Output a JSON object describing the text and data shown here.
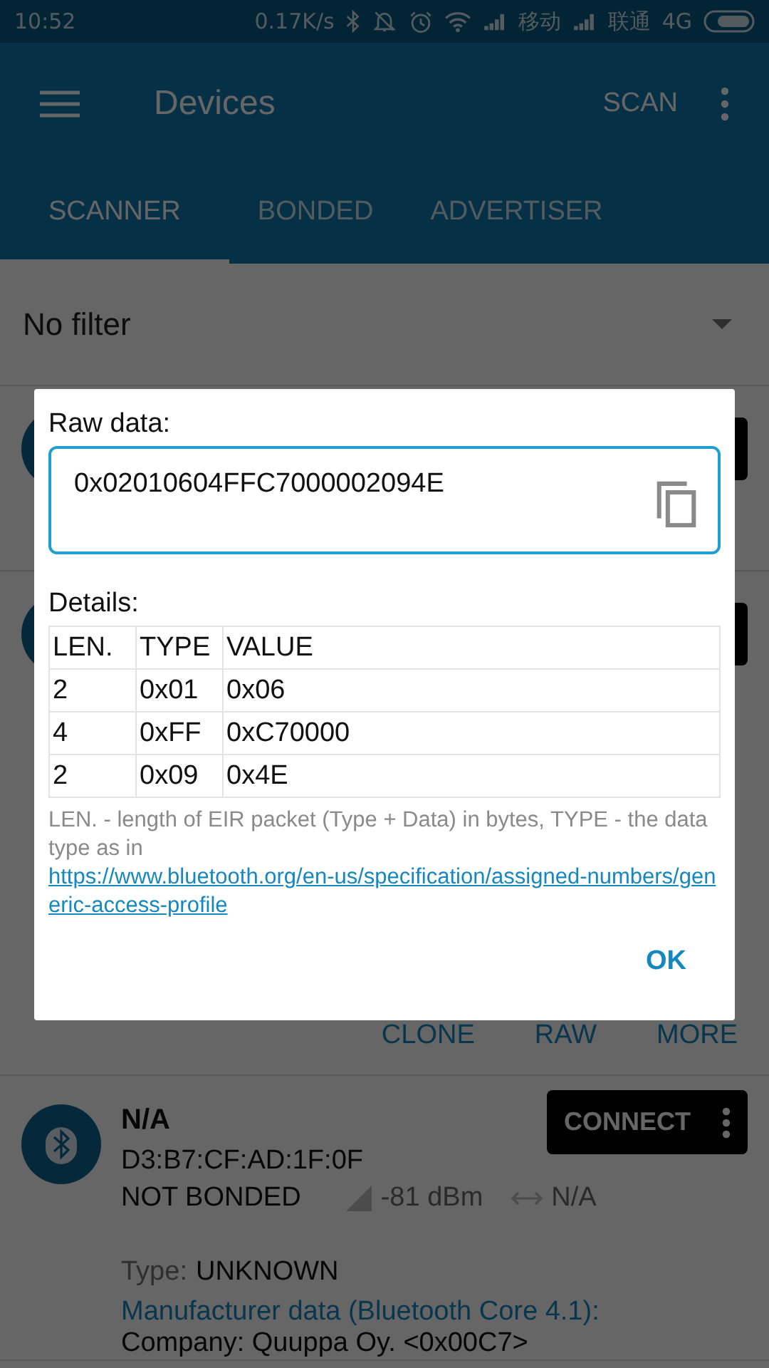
{
  "status_bar": {
    "time": "10:52",
    "net_speed": "0.17K/s",
    "carrier_1": "移动",
    "carrier_2": "联通",
    "network": "4G"
  },
  "app_bar": {
    "title": "Devices",
    "action": "SCAN"
  },
  "tabs": [
    {
      "label": "SCANNER",
      "selected": true
    },
    {
      "label": "BONDED",
      "selected": false
    },
    {
      "label": "ADVERTISER",
      "selected": false
    }
  ],
  "filter": {
    "value": "No filter"
  },
  "devices": [
    {
      "kind": "hidden"
    },
    {
      "kind": "hidden",
      "actions": [
        "CLONE",
        "RAW",
        "MORE"
      ]
    },
    {
      "kind": "full",
      "name": "N/A",
      "address": "D3:B7:CF:AD:1F:0F",
      "bond_state": "NOT BONDED",
      "rssi": "-81 dBm",
      "interval": "N/A",
      "type_label": "Type:",
      "type_value": "UNKNOWN",
      "manufacturer_heading": "Manufacturer data (Bluetooth Core 4.1):",
      "company": "Company: Quuppa Oy. <0x00C7>",
      "connect_label": "CONNECT"
    }
  ],
  "dialog": {
    "raw_label": "Raw data:",
    "raw_value": "0x02010604FFC7000002094E",
    "details_label": "Details:",
    "columns": [
      "LEN.",
      "TYPE",
      "VALUE"
    ],
    "rows": [
      [
        "2",
        "0x01",
        "0x06"
      ],
      [
        "4",
        "0xFF",
        "0xC70000"
      ],
      [
        "2",
        "0x09",
        "0x4E"
      ]
    ],
    "note": "LEN. - length of EIR packet (Type + Data) in bytes, TYPE - the data type as in",
    "link": "https://www.bluetooth.org/en-us/specification/assigned-numbers/generic-access-profile",
    "ok": "OK"
  }
}
